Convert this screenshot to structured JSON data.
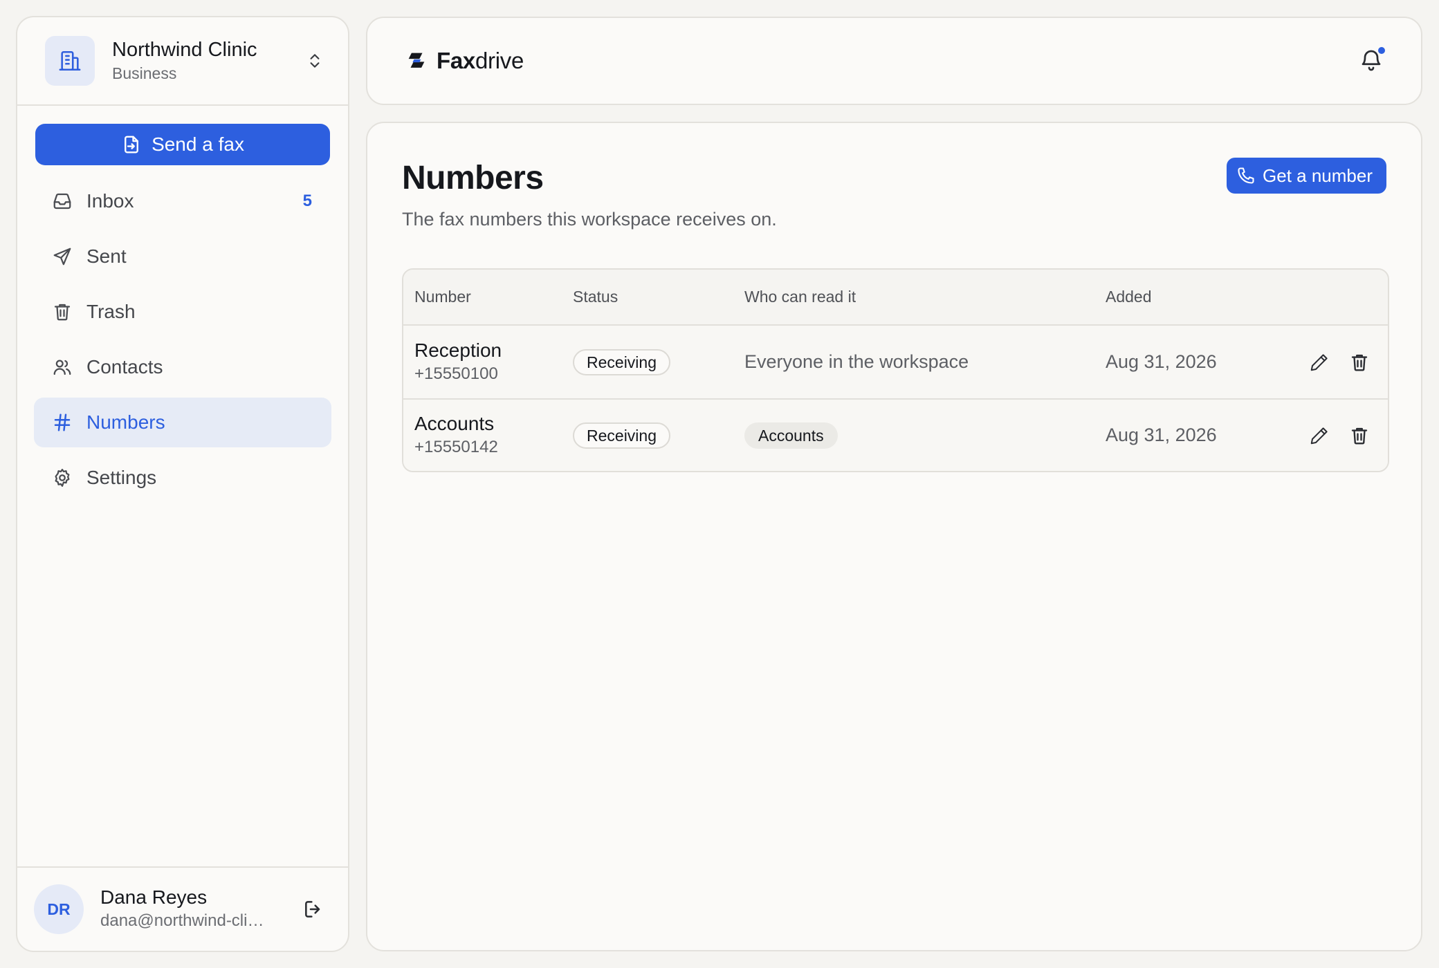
{
  "org": {
    "name": "Northwind Clinic",
    "plan": "Business",
    "icon": "building-icon"
  },
  "sidebar": {
    "send_label": "Send a fax",
    "items": [
      {
        "label": "Inbox",
        "icon": "inbox-icon",
        "badge": "5",
        "active": false
      },
      {
        "label": "Sent",
        "icon": "send-icon",
        "badge": "",
        "active": false
      },
      {
        "label": "Trash",
        "icon": "trash-icon",
        "badge": "",
        "active": false
      },
      {
        "label": "Contacts",
        "icon": "users-icon",
        "badge": "",
        "active": false
      },
      {
        "label": "Numbers",
        "icon": "hash-icon",
        "badge": "",
        "active": true
      },
      {
        "label": "Settings",
        "icon": "gear-icon",
        "badge": "",
        "active": false
      }
    ]
  },
  "user": {
    "initials": "DR",
    "name": "Dana Reyes",
    "email": "dana@northwind-cli…"
  },
  "header": {
    "brand_bold": "Fax",
    "brand_rest": "drive",
    "has_notification": true
  },
  "page": {
    "title": "Numbers",
    "subtitle": "The fax numbers this workspace receives on.",
    "primary_action": "Get a number"
  },
  "table": {
    "columns": [
      "Number",
      "Status",
      "Who can read it",
      "Added"
    ],
    "rows": [
      {
        "name": "Reception",
        "number": "+15550100",
        "status": "Receiving",
        "access": "Everyone in the workspace",
        "access_type": "text",
        "added": "Aug 31, 2026"
      },
      {
        "name": "Accounts",
        "number": "+15550142",
        "status": "Receiving",
        "access": "Accounts",
        "access_type": "tag",
        "added": "Aug 31, 2026"
      }
    ]
  },
  "colors": {
    "accent": "#2d5fdf",
    "background": "#f5f4f1",
    "panel": "#fbfaf8",
    "border": "#e3e1dc"
  }
}
